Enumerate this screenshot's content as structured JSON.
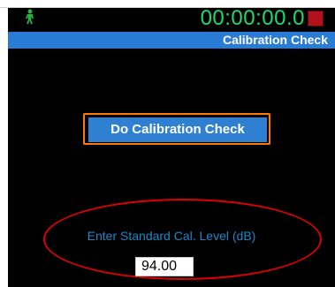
{
  "header": {
    "timer": "00:00:00.0",
    "title": "Calibration Check",
    "run_icon": "person-running-icon",
    "stop_icon": "stop-record-icon"
  },
  "main": {
    "button_label": "Do Calibration Check",
    "level_label": "Enter Standard Cal. Level (dB)",
    "level_value": "94.00"
  },
  "colors": {
    "background": "#000000",
    "titlebar": "#2a7bd6",
    "timer": "#1fd96a",
    "button": "#2f7fd3",
    "highlight_orange": "#ff7a00",
    "highlight_red": "#e00000",
    "label": "#1e86c9"
  }
}
